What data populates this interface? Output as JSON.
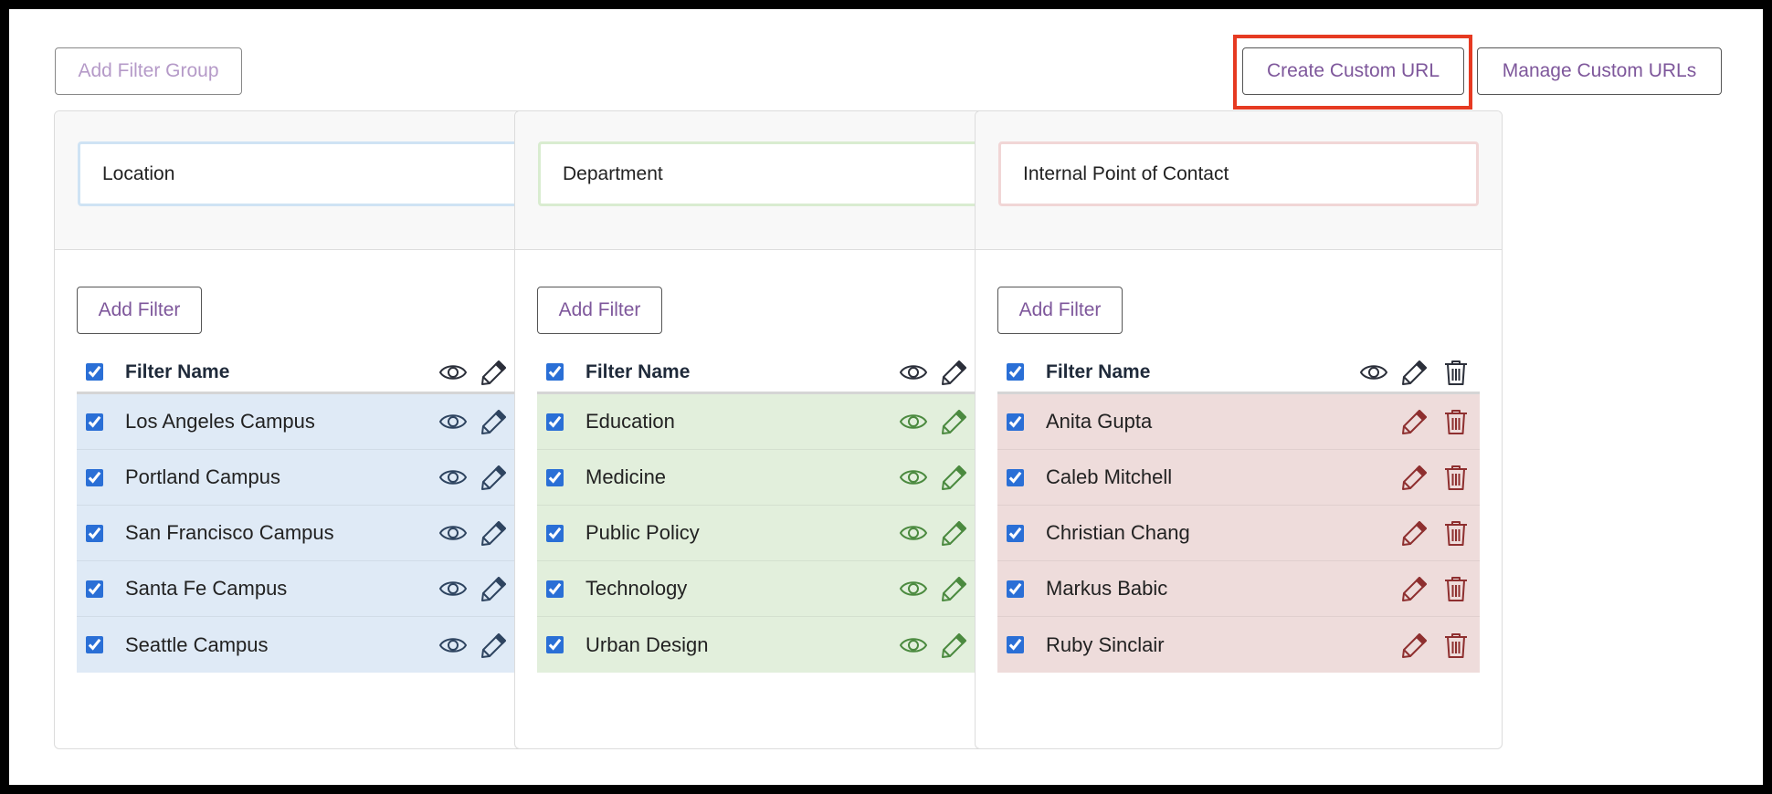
{
  "toolbar": {
    "add_filter_group_label": "Add Filter Group",
    "create_custom_url_label": "Create Custom URL",
    "manage_custom_urls_label": "Manage Custom URLs"
  },
  "colors": {
    "accent_text": "#7e579b",
    "highlight": "#e63a22",
    "checkbox": "#2a6fd6"
  },
  "groups": [
    {
      "title": "Location",
      "add_filter_label": "Add Filter",
      "header_label": "Filter Name",
      "row_bg": "#dfeaf6",
      "border_color": "#cfe3f4",
      "icon_color": "#2e4460",
      "show_visibility": true,
      "filters": [
        "Los Angeles Campus",
        "Portland Campus",
        "San Francisco Campus",
        "Santa Fe Campus",
        "Seattle Campus"
      ]
    },
    {
      "title": "Department",
      "add_filter_label": "Add Filter",
      "header_label": "Filter Name",
      "row_bg": "#e2efdc",
      "border_color": "#d9ecd0",
      "icon_color": "#4b8a3f",
      "show_visibility": true,
      "filters": [
        "Education",
        "Medicine",
        "Public Policy",
        "Technology",
        "Urban Design"
      ]
    },
    {
      "title": "Internal Point of Contact",
      "add_filter_label": "Add Filter",
      "header_label": "Filter Name",
      "row_bg": "#eedcdb",
      "border_color": "#f1d6d6",
      "icon_color": "#8e2f2f",
      "show_visibility": false,
      "filters": [
        "Anita Gupta",
        "Caleb Mitchell",
        "Christian Chang",
        "Markus Babic",
        "Ruby Sinclair"
      ]
    }
  ]
}
